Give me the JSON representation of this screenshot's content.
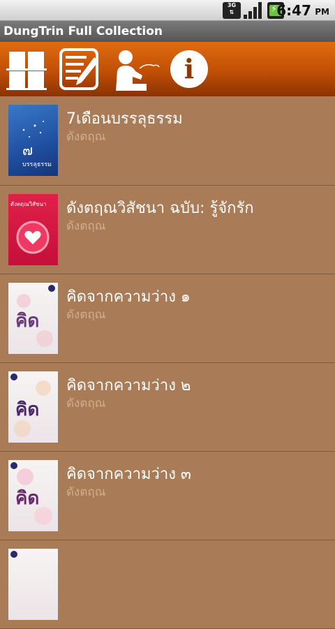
{
  "status_bar": {
    "network": "3G",
    "time": "6:47",
    "ampm": "PM"
  },
  "app": {
    "title": "DungTrin Full Collection"
  },
  "toolbar": {
    "buttons": [
      {
        "icon": "grid-icon"
      },
      {
        "icon": "notes-icon"
      },
      {
        "icon": "author-icon"
      },
      {
        "icon": "info-icon",
        "glyph": "i"
      }
    ]
  },
  "books": [
    {
      "title": "7เดือนบรรลุธรรม",
      "author": "ดังตฤณ",
      "cover_text": "บรรลุธรรม"
    },
    {
      "title": "ดังตฤณวิสัชนา ฉบับ: รู้จักรัก",
      "author": "ดังตฤณ",
      "cover_text": "ดังตฤณวิสัชนา"
    },
    {
      "title": "คิดจากความว่าง ๑",
      "author": "ดังตฤณ",
      "cover_text": "คิด"
    },
    {
      "title": "คิดจากความว่าง ๒",
      "author": "ดังตฤณ",
      "cover_text": "คิด"
    },
    {
      "title": "คิดจากความว่าง ๓",
      "author": "ดังตฤณ",
      "cover_text": "คิด"
    }
  ]
}
